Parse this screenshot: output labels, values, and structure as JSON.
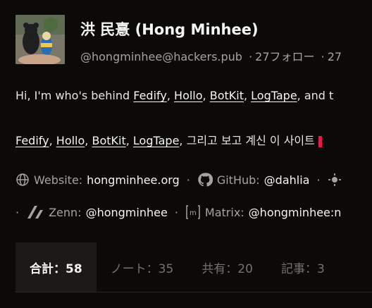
{
  "profile": {
    "name": "洪 民憙 (Hong Minhee)",
    "handle": "@hongminhee@hackers.pub",
    "sep": "·",
    "following": "27フォロー",
    "followers_partial": "27"
  },
  "bio_en": {
    "prefix": "Hi, I'm who's behind ",
    "links": [
      "Fedify",
      "Hollo",
      "BotKit",
      "LogTape"
    ],
    "comma": ",",
    "suffix": ", and t"
  },
  "bio_ko": {
    "links": [
      "Fedify",
      "Hollo",
      "BotKit",
      "LogTape"
    ],
    "comma": ",",
    "suffix": ", 그리고 보고 계신 이 사이트 "
  },
  "fields": {
    "website": {
      "label": "Website:",
      "value": "hongminhee.org",
      "icon": "globe-icon"
    },
    "github": {
      "label": "GitHub:",
      "value": "@dahlia",
      "icon": "github-icon"
    },
    "zenn": {
      "label": "Zenn:",
      "value": "@hongminhee",
      "icon": "zenn-icon"
    },
    "matrix": {
      "label": "Matrix:",
      "value": "@hongminhee:n",
      "icon": "matrix-icon"
    },
    "sep": "·"
  },
  "tabs": [
    {
      "label": "合計：58"
    },
    {
      "label": "ノート：35"
    },
    {
      "label": "共有：20"
    },
    {
      "label": "記事：3"
    }
  ],
  "colors": {
    "background": "#0c0a09",
    "text": "#e7e5e4",
    "muted": "#a8a29e",
    "active_tab_bg": "#1c1917"
  }
}
